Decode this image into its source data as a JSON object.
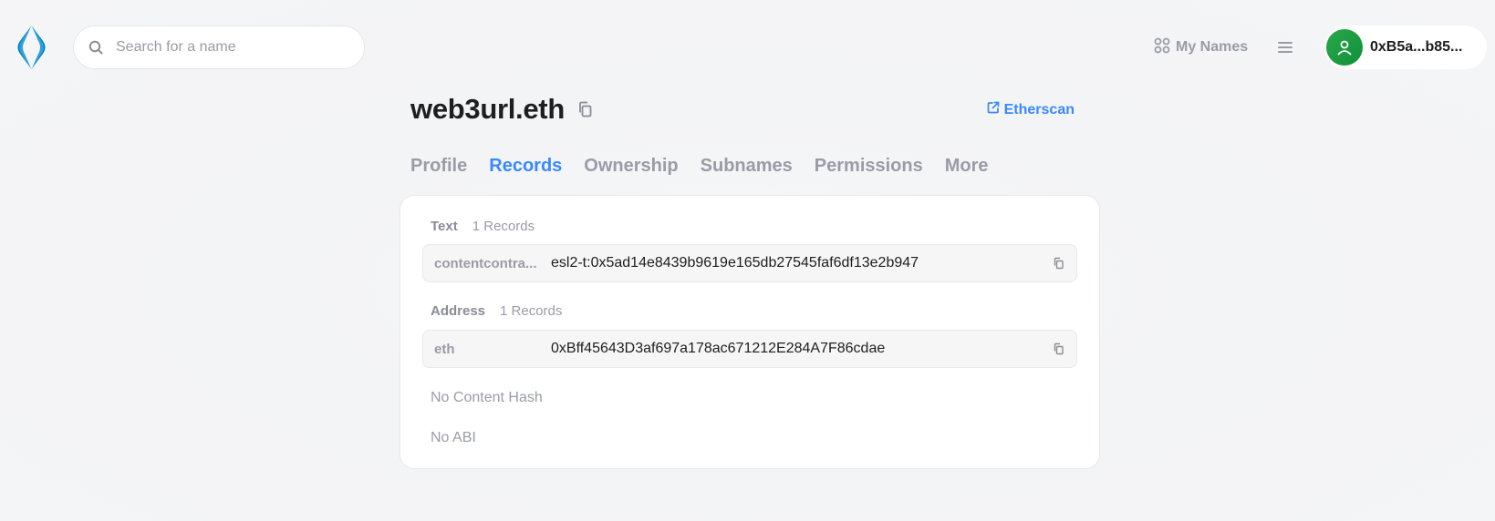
{
  "header": {
    "search_placeholder": "Search for a name",
    "my_names_label": "My Names",
    "account_label": "0xB5a...b85..."
  },
  "name": {
    "title": "web3url.eth",
    "etherscan_label": "Etherscan"
  },
  "tabs": [
    {
      "label": "Profile",
      "active": false
    },
    {
      "label": "Records",
      "active": true
    },
    {
      "label": "Ownership",
      "active": false
    },
    {
      "label": "Subnames",
      "active": false
    },
    {
      "label": "Permissions",
      "active": false
    },
    {
      "label": "More",
      "active": false
    }
  ],
  "records": {
    "text": {
      "label": "Text",
      "count": "1 Records",
      "items": [
        {
          "key": "contentcontra...",
          "value": "esl2-t:0x5ad14e8439b9619e165db27545faf6df13e2b947"
        }
      ]
    },
    "address": {
      "label": "Address",
      "count": "1 Records",
      "items": [
        {
          "key": "eth",
          "value": "0xBff45643D3af697a178ac671212E284A7F86cdae"
        }
      ]
    },
    "content_hash_empty": "No Content Hash",
    "abi_empty": "No ABI"
  },
  "colors": {
    "accent": "#3889ff",
    "muted": "#9b9ba7",
    "avatar": "#1f9c44",
    "logo": "#0080bc"
  },
  "icons": [
    "ens-logo-icon",
    "search-icon",
    "grid-icon",
    "menu-icon",
    "user-icon",
    "copy-icon",
    "external-link-icon"
  ]
}
